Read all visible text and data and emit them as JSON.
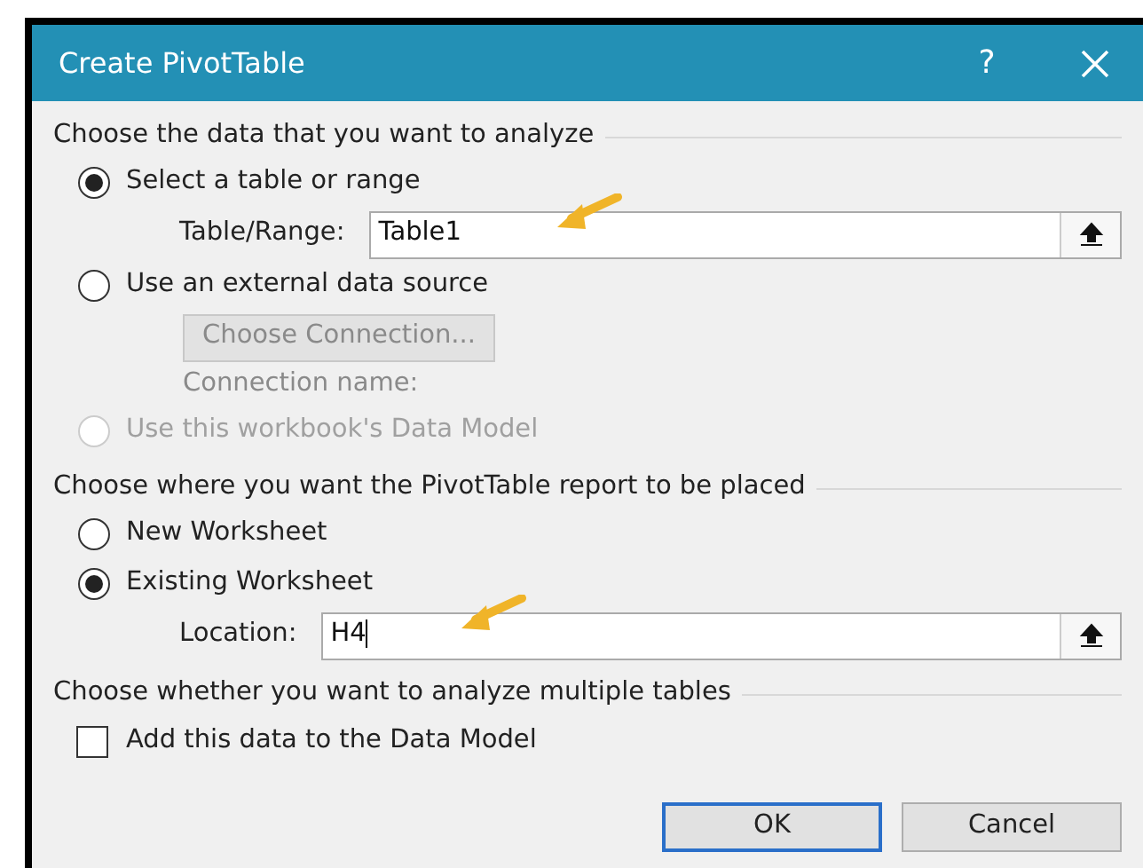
{
  "window": {
    "title": "Create PivotTable",
    "help": "?"
  },
  "sections": [
    {
      "title": "Choose the data that you want to analyze",
      "items": [
        {
          "kind": "radio",
          "label": "Select a table or range",
          "selected": true,
          "disabled": false
        },
        {
          "kind": "field",
          "label": "Table/Range:",
          "value": "Table1",
          "annotated": true,
          "focused": false
        },
        {
          "kind": "radio",
          "label": "Use an external data source",
          "selected": false,
          "disabled": false
        },
        {
          "kind": "button",
          "label": "Choose Connection...",
          "disabled": true
        },
        {
          "kind": "label",
          "label": "Connection name:",
          "disabled": true
        },
        {
          "kind": "radio",
          "label": "Use this workbook's Data Model",
          "selected": false,
          "disabled": true
        }
      ]
    },
    {
      "title": "Choose where you want the PivotTable report to be placed",
      "items": [
        {
          "kind": "radio",
          "label": "New Worksheet",
          "selected": false,
          "disabled": false
        },
        {
          "kind": "radio",
          "label": "Existing Worksheet",
          "selected": true,
          "disabled": false
        },
        {
          "kind": "field",
          "label": "Location:",
          "value": "H4",
          "annotated": true,
          "focused": true
        }
      ]
    },
    {
      "title": "Choose whether you want to analyze multiple tables",
      "items": [
        {
          "kind": "checkbox",
          "label": "Add this data to the Data Model",
          "checked": false
        }
      ]
    }
  ],
  "buttons": [
    {
      "label": "OK",
      "default": true
    },
    {
      "label": "Cancel",
      "default": false
    }
  ]
}
